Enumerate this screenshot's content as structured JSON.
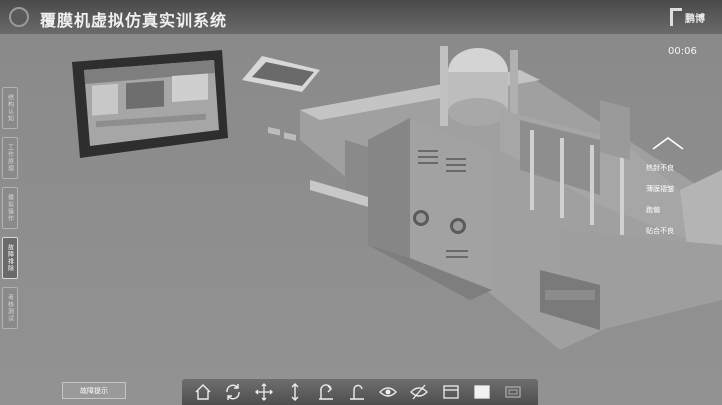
{
  "app": {
    "title": "覆膜机虚拟仿真实训系统",
    "brand": "鹏博"
  },
  "timer": "00:06",
  "side_menu": [
    {
      "label": "结构认知",
      "active": false
    },
    {
      "label": "工作原理",
      "active": false
    },
    {
      "label": "模拟操作",
      "active": false
    },
    {
      "label": "故障排除",
      "active": true
    },
    {
      "label": "考核测试",
      "active": false
    }
  ],
  "fault_hint_button": "故障提示",
  "popup_menu": {
    "items": [
      "热封不良",
      "薄膜褶皱",
      "跑偏",
      "贴合不良"
    ]
  },
  "toolbar": {
    "tools": [
      "home-icon",
      "rotate-icon",
      "move-icon",
      "vertical-move-icon",
      "rotate-view-icon",
      "reset-view-icon",
      "show-icon",
      "hide-icon",
      "window-icon",
      "fill-icon",
      "screen-icon"
    ]
  },
  "colors": {
    "background": "#8c8c8c",
    "title_bar": "#4a4a4a",
    "machine": "#b8b8b8",
    "accent_text": "#ffffff"
  }
}
